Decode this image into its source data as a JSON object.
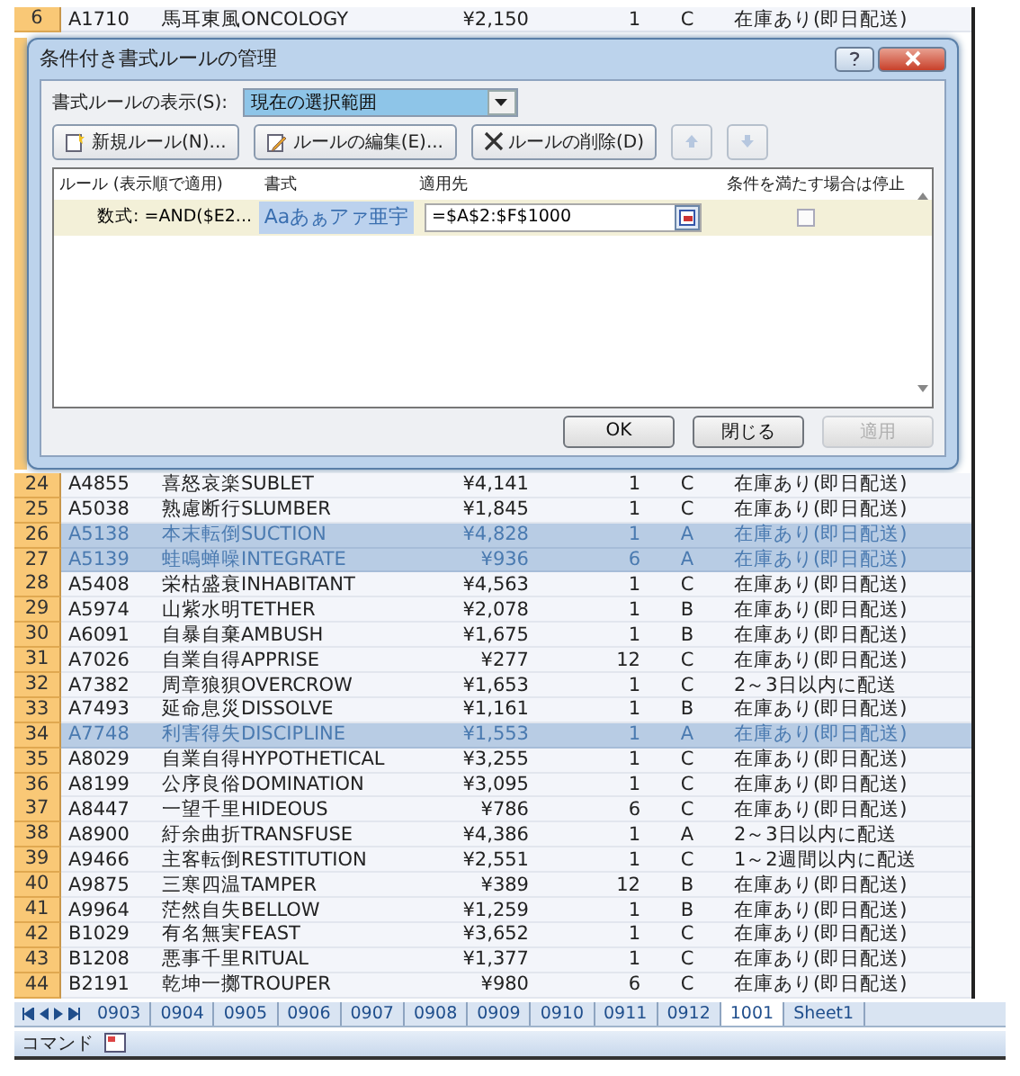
{
  "top_rows": [
    {
      "row": "6",
      "code": "A1710",
      "name": "馬耳東風ONCOLOGY",
      "price": "¥2,150",
      "qty": "1",
      "rank": "C",
      "stock": "在庫あり(即日配送)",
      "highlighted": false
    }
  ],
  "dialog": {
    "title": "条件付き書式ルールの管理",
    "show_label": "書式ルールの表示(S):",
    "show_value": "現在の選択範囲",
    "toolbar": [
      {
        "kind": "new",
        "label": "新規ルール(N)..."
      },
      {
        "kind": "edit",
        "label": "ルールの編集(E)..."
      },
      {
        "kind": "delete",
        "label": "ルールの削除(D)"
      },
      {
        "kind": "up",
        "disabled": true
      },
      {
        "kind": "down",
        "disabled": true
      }
    ],
    "columns": [
      "ルール (表示順で適用)",
      "書式",
      "適用先",
      "条件を満たす場合は停止"
    ],
    "rules": [
      {
        "rule": "数式: =AND($E2...",
        "preview": "Aaあぁアァ亜宇",
        "applies_to": "=$A$2:$F$1000",
        "stop": false,
        "selected": true
      }
    ],
    "buttons": [
      {
        "label": "OK",
        "disabled": false
      },
      {
        "label": "閉じる",
        "disabled": false
      },
      {
        "label": "適用",
        "disabled": true
      }
    ]
  },
  "rows": [
    {
      "row": "24",
      "code": "A4855",
      "name": "喜怒哀楽SUBLET",
      "price": "¥4,141",
      "qty": "1",
      "rank": "C",
      "stock": "在庫あり(即日配送)",
      "highlighted": false
    },
    {
      "row": "25",
      "code": "A5038",
      "name": "熟慮断行SLUMBER",
      "price": "¥1,845",
      "qty": "1",
      "rank": "C",
      "stock": "在庫あり(即日配送)",
      "highlighted": false
    },
    {
      "row": "26",
      "code": "A5138",
      "name": "本末転倒SUCTION",
      "price": "¥4,828",
      "qty": "1",
      "rank": "A",
      "stock": "在庫あり(即日配送)",
      "highlighted": true
    },
    {
      "row": "27",
      "code": "A5139",
      "name": "蛙鳴蝉噪INTEGRATE",
      "price": "¥936",
      "qty": "6",
      "rank": "A",
      "stock": "在庫あり(即日配送)",
      "highlighted": true
    },
    {
      "row": "28",
      "code": "A5408",
      "name": "栄枯盛衰INHABITANT",
      "price": "¥4,563",
      "qty": "1",
      "rank": "C",
      "stock": "在庫あり(即日配送)",
      "highlighted": false
    },
    {
      "row": "29",
      "code": "A5974",
      "name": "山紫水明TETHER",
      "price": "¥2,078",
      "qty": "1",
      "rank": "B",
      "stock": "在庫あり(即日配送)",
      "highlighted": false
    },
    {
      "row": "30",
      "code": "A6091",
      "name": "自暴自棄AMBUSH",
      "price": "¥1,675",
      "qty": "1",
      "rank": "B",
      "stock": "在庫あり(即日配送)",
      "highlighted": false
    },
    {
      "row": "31",
      "code": "A7026",
      "name": "自業自得APPRISE",
      "price": "¥277",
      "qty": "12",
      "rank": "C",
      "stock": "在庫あり(即日配送)",
      "highlighted": false
    },
    {
      "row": "32",
      "code": "A7382",
      "name": "周章狼狽OVERCROW",
      "price": "¥1,653",
      "qty": "1",
      "rank": "C",
      "stock": "2～3日以内に配送",
      "highlighted": false
    },
    {
      "row": "33",
      "code": "A7493",
      "name": "延命息災DISSOLVE",
      "price": "¥1,161",
      "qty": "1",
      "rank": "B",
      "stock": "在庫あり(即日配送)",
      "highlighted": false
    },
    {
      "row": "34",
      "code": "A7748",
      "name": "利害得失DISCIPLINE",
      "price": "¥1,553",
      "qty": "1",
      "rank": "A",
      "stock": "在庫あり(即日配送)",
      "highlighted": true
    },
    {
      "row": "35",
      "code": "A8029",
      "name": "自業自得HYPOTHETICAL",
      "price": "¥3,255",
      "qty": "1",
      "rank": "C",
      "stock": "在庫あり(即日配送)",
      "highlighted": false
    },
    {
      "row": "36",
      "code": "A8199",
      "name": "公序良俗DOMINATION",
      "price": "¥3,095",
      "qty": "1",
      "rank": "C",
      "stock": "在庫あり(即日配送)",
      "highlighted": false
    },
    {
      "row": "37",
      "code": "A8447",
      "name": "一望千里HIDEOUS",
      "price": "¥786",
      "qty": "6",
      "rank": "C",
      "stock": "在庫あり(即日配送)",
      "highlighted": false
    },
    {
      "row": "38",
      "code": "A8900",
      "name": "紆余曲折TRANSFUSE",
      "price": "¥4,386",
      "qty": "1",
      "rank": "A",
      "stock": "2～3日以内に配送",
      "highlighted": false
    },
    {
      "row": "39",
      "code": "A9466",
      "name": "主客転倒RESTITUTION",
      "price": "¥2,551",
      "qty": "1",
      "rank": "C",
      "stock": "1～2週間以内に配送",
      "highlighted": false
    },
    {
      "row": "40",
      "code": "A9875",
      "name": "三寒四温TAMPER",
      "price": "¥389",
      "qty": "12",
      "rank": "B",
      "stock": "在庫あり(即日配送)",
      "highlighted": false
    },
    {
      "row": "41",
      "code": "A9964",
      "name": "茫然自失BELLOW",
      "price": "¥1,259",
      "qty": "1",
      "rank": "B",
      "stock": "在庫あり(即日配送)",
      "highlighted": false
    },
    {
      "row": "42",
      "code": "B1029",
      "name": "有名無実FEAST",
      "price": "¥3,652",
      "qty": "1",
      "rank": "C",
      "stock": "在庫あり(即日配送)",
      "highlighted": false
    },
    {
      "row": "43",
      "code": "B1208",
      "name": "悪事千里RITUAL",
      "price": "¥1,377",
      "qty": "1",
      "rank": "C",
      "stock": "在庫あり(即日配送)",
      "highlighted": false
    },
    {
      "row": "44",
      "code": "B2191",
      "name": "乾坤一擲TROUPER",
      "price": "¥980",
      "qty": "6",
      "rank": "C",
      "stock": "在庫あり(即日配送)",
      "highlighted": false
    }
  ],
  "sheet_tabs": [
    {
      "label": "0903",
      "selected": false
    },
    {
      "label": "0904",
      "selected": false
    },
    {
      "label": "0905",
      "selected": false
    },
    {
      "label": "0906",
      "selected": false
    },
    {
      "label": "0907",
      "selected": false
    },
    {
      "label": "0908",
      "selected": false
    },
    {
      "label": "0909",
      "selected": false
    },
    {
      "label": "0910",
      "selected": false
    },
    {
      "label": "0911",
      "selected": false
    },
    {
      "label": "0912",
      "selected": false
    },
    {
      "label": "1001",
      "selected": true
    },
    {
      "label": "Sheet1",
      "selected": false
    }
  ],
  "status_bar": {
    "mode": "コマンド"
  }
}
